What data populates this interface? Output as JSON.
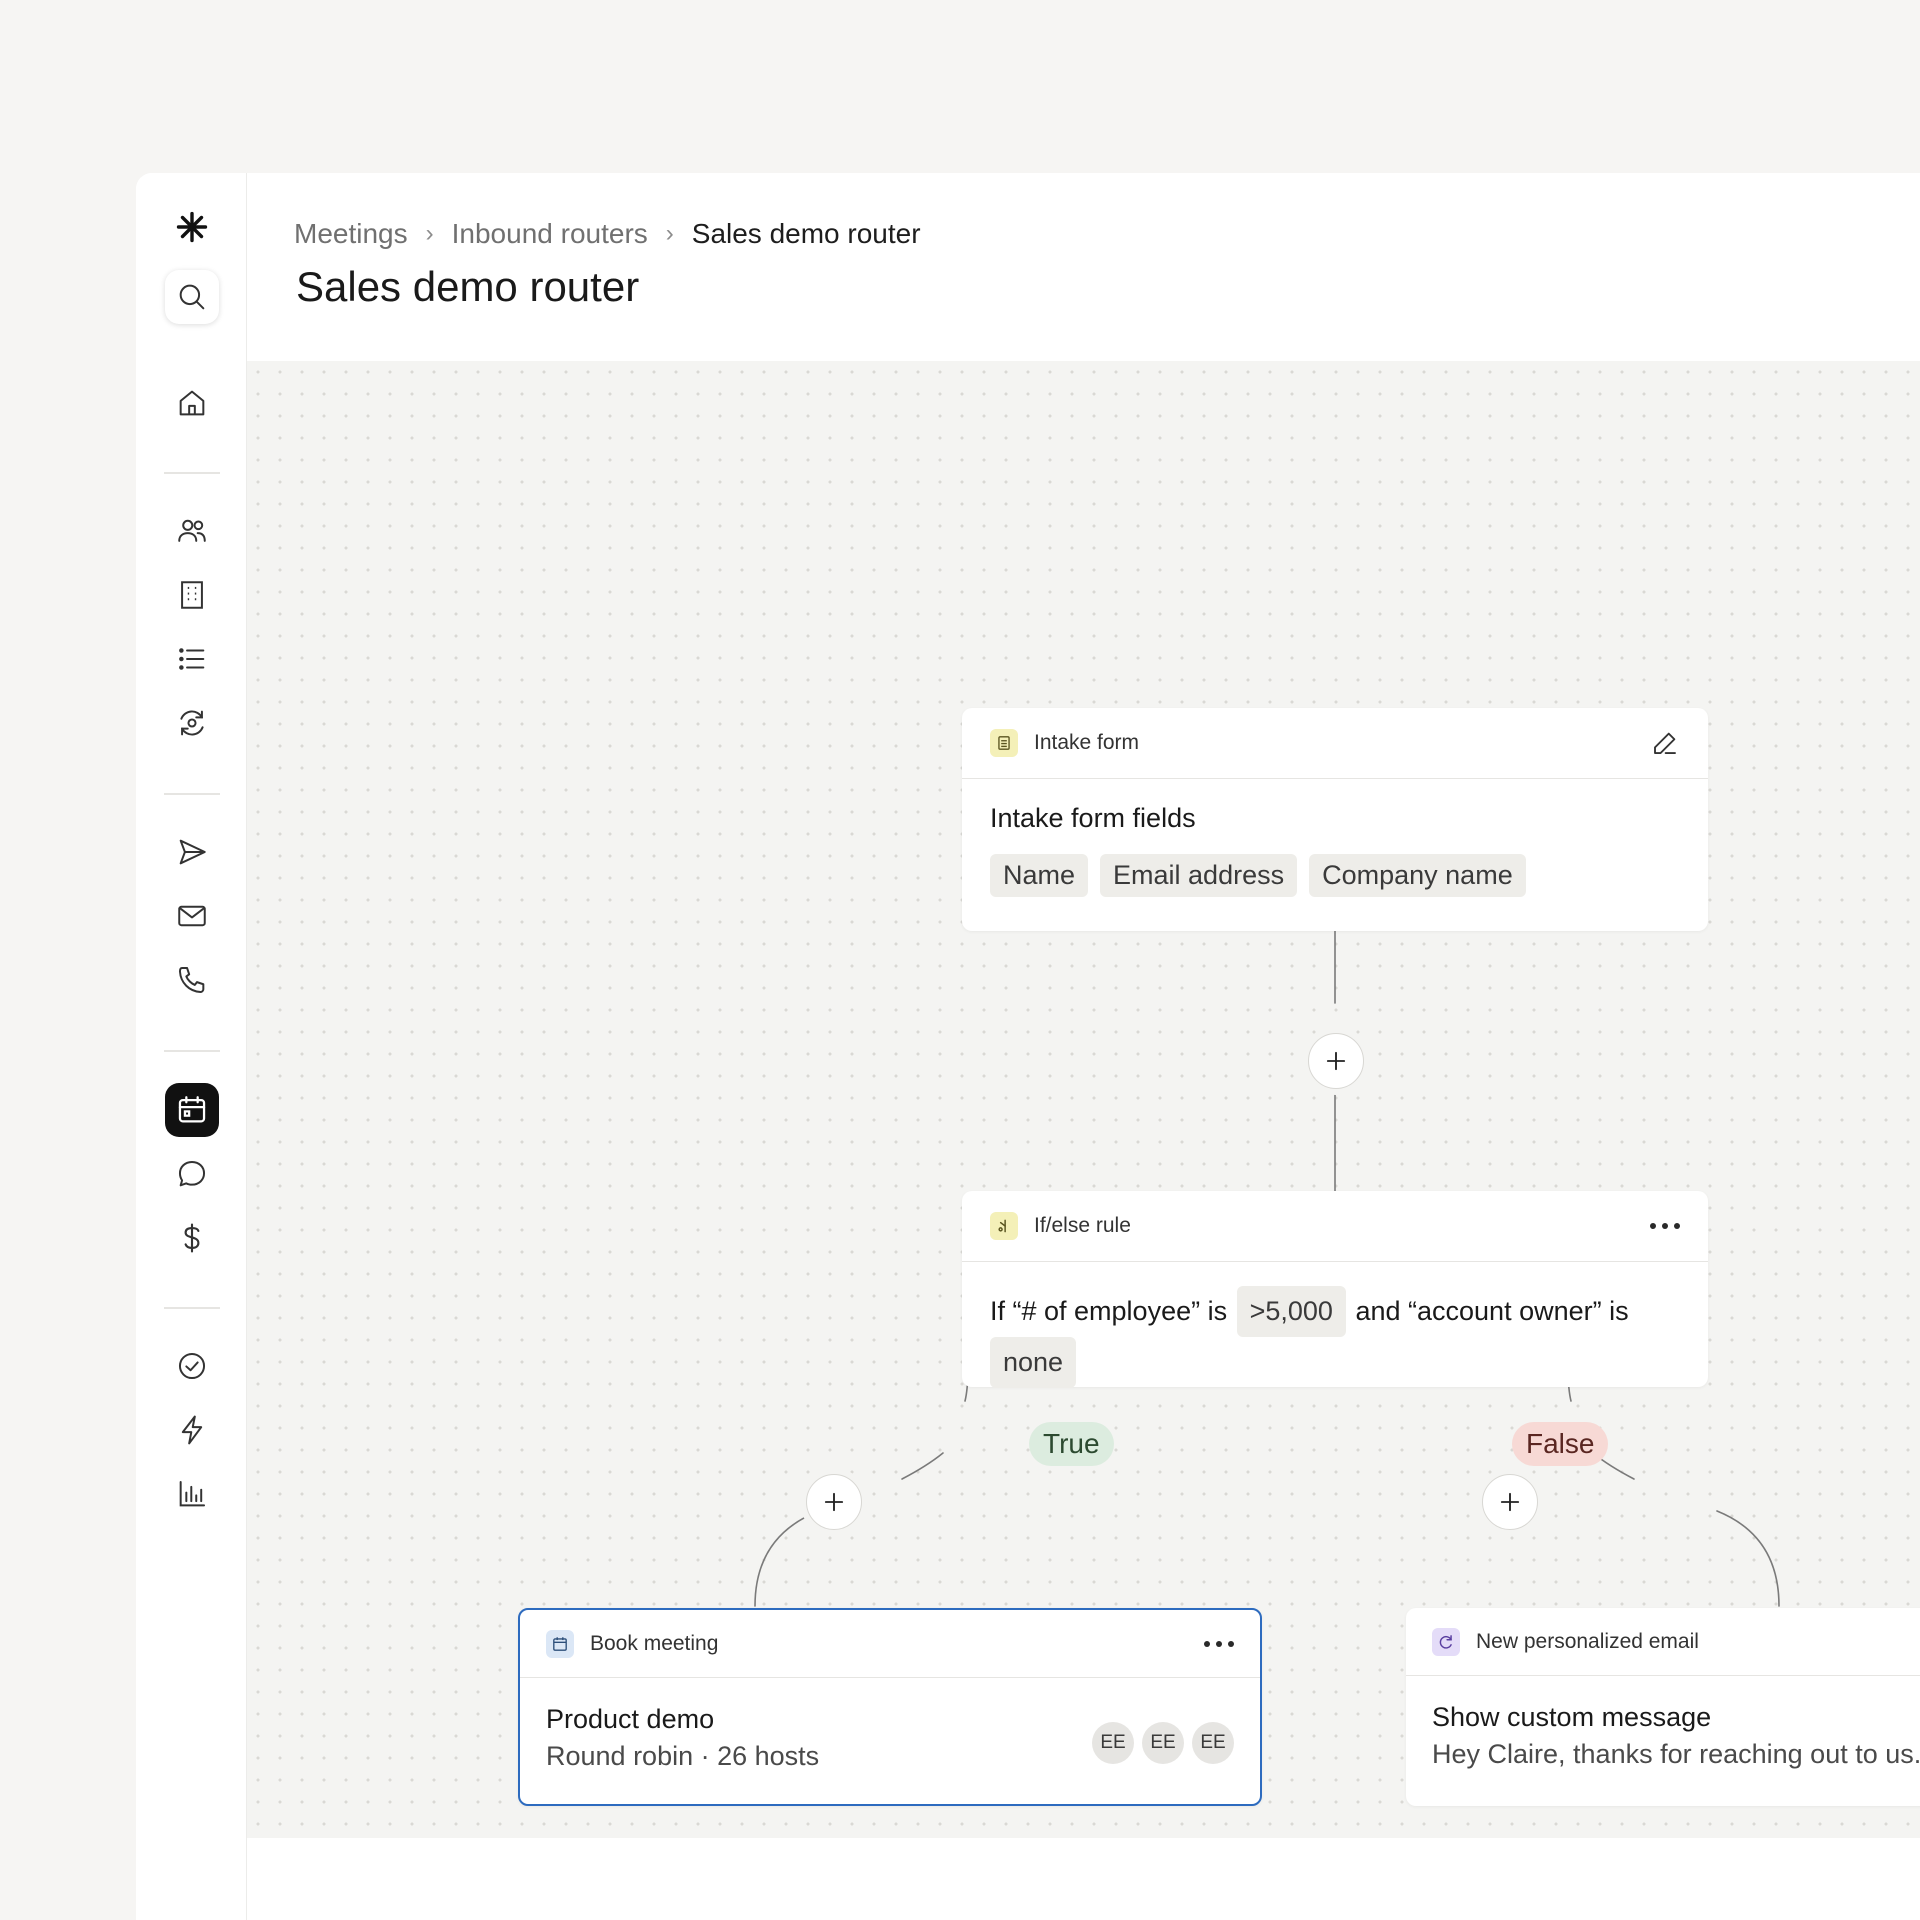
{
  "sidebar": {
    "icons": [
      "asterisk-logo-icon",
      "search-icon",
      "home-icon",
      "people-icon",
      "building-icon",
      "list-icon",
      "refresh-eye-icon",
      "send-icon",
      "mail-icon",
      "phone-icon",
      "calendar-icon",
      "chat-icon",
      "dollar-icon",
      "check-circle-icon",
      "lightning-icon",
      "bar-chart-icon"
    ],
    "active": "calendar-icon"
  },
  "breadcrumb": {
    "items": [
      "Meetings",
      "Inbound routers",
      "Sales demo router"
    ]
  },
  "page": {
    "title": "Sales demo router"
  },
  "nodes": {
    "intake": {
      "type": "Intake form",
      "title": "Intake form fields",
      "fields": [
        "Name",
        "Email address",
        "Company name"
      ]
    },
    "rule": {
      "type": "If/else rule",
      "condition_prefix": "If “# of employee” is",
      "value1": ">5,000",
      "condition_middle": "and “account owner” is",
      "value2": "none"
    },
    "branches": {
      "true_label": "True",
      "false_label": "False"
    },
    "book": {
      "type": "Book meeting",
      "title": "Product demo",
      "subtitle": "Round robin · 26 hosts",
      "avatars": [
        "EE",
        "EE",
        "EE"
      ]
    },
    "email": {
      "type": "New personalized email",
      "title": "Show custom message",
      "message": "Hey Claire, thanks for reaching out to us. While we s"
    }
  },
  "colors": {
    "intake_icon_bg": "#f4f0b8",
    "rule_icon_bg": "#f4f0b8",
    "book_icon_bg": "#dbe7f6",
    "email_icon_bg": "#e4dcf8",
    "selected_border": "#2d6bbf"
  }
}
